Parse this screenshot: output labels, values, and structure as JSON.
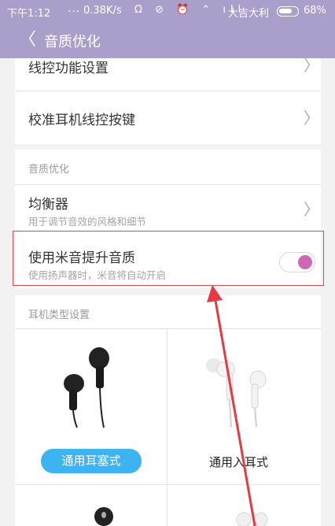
{
  "status": {
    "time": "下午1:12",
    "dots": "...",
    "speed": "0.38K/s",
    "icons": "Ω ⊘ ⏰ ⌃ ıll",
    "carrier": "大吉大利",
    "battery": "68%"
  },
  "header": {
    "back_glyph": "〈",
    "title": "音质优化"
  },
  "rows": {
    "line_control": "线控功能设置",
    "calibrate": "校准耳机线控按键",
    "chevron": "〉"
  },
  "quality": {
    "section_label": "音质优化",
    "equalizer_title": "均衡器",
    "equalizer_sub": "用于调节音效的风格和细节",
    "miyin_title": "使用米音提升音质",
    "miyin_sub": "使用扬声器时，米音将自动开启",
    "miyin_enabled": true
  },
  "earphones": {
    "section_label": "耳机类型设置",
    "options": [
      {
        "label": "通用耳塞式",
        "selected": true
      },
      {
        "label": "通用入耳式",
        "selected": false
      }
    ]
  },
  "colors": {
    "header": "#aa9fca",
    "toggle_on": "#d067b6",
    "chip": "#3eb3f2",
    "annotation": "#e53a43"
  }
}
